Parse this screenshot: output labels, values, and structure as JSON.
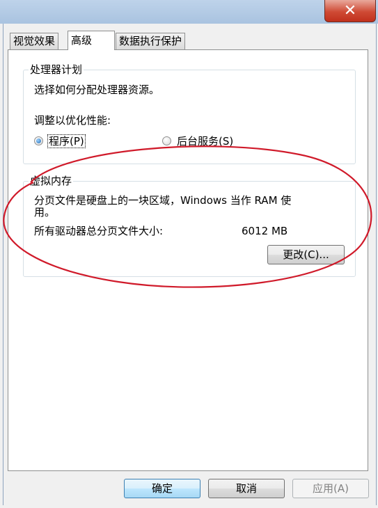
{
  "window": {
    "close_glyph": "✕"
  },
  "tabs": [
    {
      "label": "视觉效果",
      "active": false
    },
    {
      "label": "高级",
      "active": true
    },
    {
      "label": "数据执行保护",
      "active": false
    }
  ],
  "processor_group": {
    "title": "处理器计划",
    "description": "选择如何分配处理器资源。",
    "adjust_label": "调整以优化性能:",
    "option_programs": "程序(P)",
    "option_background": "后台服务(S)",
    "selected": "程序(P)"
  },
  "virtual_memory_group": {
    "title": "虚拟内存",
    "description_line1": "分页文件是硬盘上的一块区域，Windows 当作 RAM 使",
    "description_line2": "用。",
    "total_label": "所有驱动器总分页文件大小:",
    "total_value": "6012 MB",
    "change_button": "更改(C)..."
  },
  "footer": {
    "ok": "确定",
    "cancel": "取消",
    "apply": "应用(A)"
  },
  "colors": {
    "annotation_ellipse": "#d01a2a",
    "default_button_border": "#3c7fb1"
  }
}
